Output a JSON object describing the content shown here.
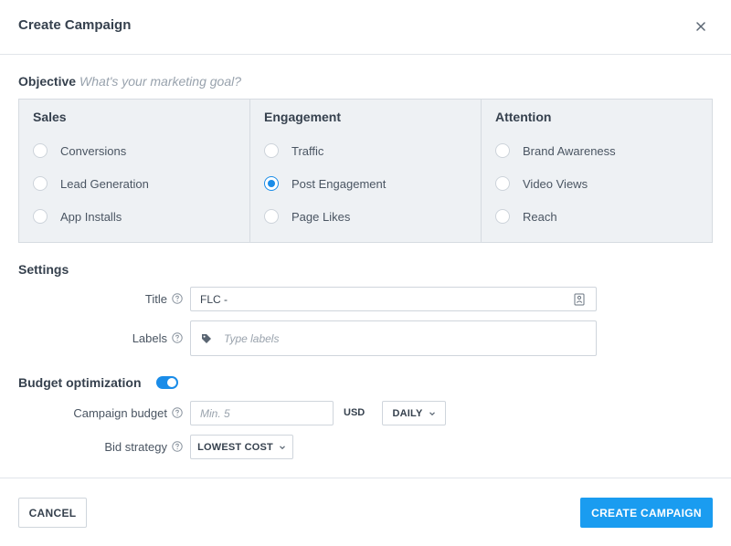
{
  "dialog": {
    "title": "Create Campaign"
  },
  "objective": {
    "heading": "Objective",
    "hint": "What's your marketing goal?",
    "columns": [
      {
        "title": "Sales",
        "options": [
          {
            "label": "Conversions",
            "selected": false
          },
          {
            "label": "Lead Generation",
            "selected": false
          },
          {
            "label": "App Installs",
            "selected": false
          }
        ]
      },
      {
        "title": "Engagement",
        "options": [
          {
            "label": "Traffic",
            "selected": false
          },
          {
            "label": "Post Engagement",
            "selected": true
          },
          {
            "label": "Page Likes",
            "selected": false
          }
        ]
      },
      {
        "title": "Attention",
        "options": [
          {
            "label": "Brand Awareness",
            "selected": false
          },
          {
            "label": "Video Views",
            "selected": false
          },
          {
            "label": "Reach",
            "selected": false
          }
        ]
      }
    ]
  },
  "settings": {
    "heading": "Settings",
    "title_label": "Title",
    "title_value": "FLC -",
    "labels_label": "Labels",
    "labels_placeholder": "Type labels"
  },
  "budget": {
    "heading": "Budget optimization",
    "enabled": true,
    "campaign_budget_label": "Campaign budget",
    "campaign_budget_placeholder": "Min. 5",
    "currency": "USD",
    "period": "DAILY",
    "bid_strategy_label": "Bid strategy",
    "bid_strategy": "LOWEST COST"
  },
  "footer": {
    "cancel_label": "CANCEL",
    "create_label": "CREATE CAMPAIGN"
  },
  "colors": {
    "accent": "#1a9cf0",
    "radio_selected": "#1a8ce8",
    "panel_bg": "#eef1f4"
  },
  "icons": {
    "close": "close-icon",
    "help": "question-circle-icon",
    "tag": "tag-icon",
    "contact_card": "contact-card-icon",
    "chevron": "chevron-down-icon"
  }
}
